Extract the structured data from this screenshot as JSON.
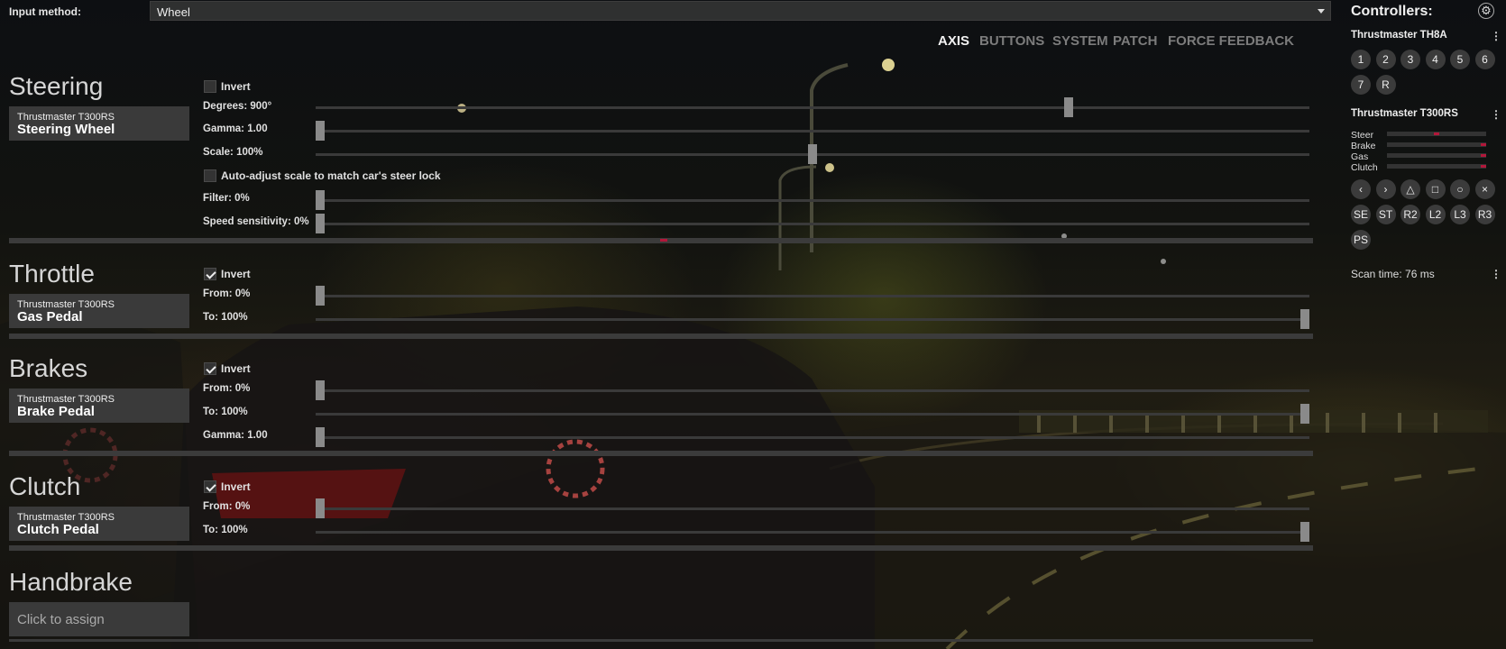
{
  "top": {
    "input_label": "Input method:",
    "input_value": "Wheel"
  },
  "tabs": [
    "AXIS",
    "BUTTONS",
    "SYSTEM",
    "PATCH",
    "FORCE FEEDBACK"
  ],
  "steering": {
    "title": "Steering",
    "vendor": "Thrustmaster T300RS",
    "device": "Steering Wheel",
    "invert_label": "Invert",
    "invert_checked": false,
    "degrees_label": "Degrees: 900°",
    "degrees_fraction": 0.76,
    "gamma_label": "Gamma: 1.00",
    "gamma_fraction": 0.0,
    "scale_label": "Scale: 100%",
    "scale_fraction": 0.5,
    "autoadjust_label": "Auto-adjust scale to match car's steer lock",
    "filter_label": "Filter: 0%",
    "filter_fraction": 0.0,
    "speed_label": "Speed sensitivity: 0%",
    "speed_fraction": 0.0
  },
  "throttle": {
    "title": "Throttle",
    "vendor": "Thrustmaster T300RS",
    "device": "Gas Pedal",
    "invert_label": "Invert",
    "invert_checked": true,
    "from_label": "From: 0%",
    "from_fraction": 0.0,
    "to_label": "To: 100%",
    "to_fraction": 1.0
  },
  "brakes": {
    "title": "Brakes",
    "vendor": "Thrustmaster T300RS",
    "device": "Brake Pedal",
    "invert_label": "Invert",
    "invert_checked": true,
    "from_label": "From: 0%",
    "from_fraction": 0.0,
    "to_label": "To: 100%",
    "to_fraction": 1.0,
    "gamma_label": "Gamma: 1.00",
    "gamma_fraction": 0.0
  },
  "clutch": {
    "title": "Clutch",
    "vendor": "Thrustmaster T300RS",
    "device": "Clutch Pedal",
    "invert_label": "Invert",
    "invert_checked": true,
    "from_label": "From: 0%",
    "from_fraction": 0.0,
    "to_label": "To: 100%",
    "to_fraction": 1.0
  },
  "handbrake": {
    "title": "Handbrake",
    "assign_text": "Click to assign"
  },
  "controllers": {
    "title": "Controllers:",
    "device1": {
      "name": "Thrustmaster TH8A",
      "buttons": [
        "1",
        "2",
        "3",
        "4",
        "5",
        "6",
        "7",
        "R"
      ]
    },
    "device2": {
      "name": "Thrustmaster T300RS",
      "axes": [
        {
          "name": "Steer",
          "value": 0.5
        },
        {
          "name": "Brake",
          "value": 1.0
        },
        {
          "name": "Gas",
          "value": 1.0
        },
        {
          "name": "Clutch",
          "value": 1.0
        }
      ],
      "buttons_row1": [
        "‹",
        "›",
        "△",
        "□",
        "○",
        "×"
      ],
      "buttons_row2": [
        "SE",
        "ST",
        "R2",
        "L2",
        "L3",
        "R3"
      ],
      "buttons_row3": [
        "PS"
      ]
    },
    "scan_time": "Scan time: 76 ms"
  },
  "colors": {
    "accent_red": "#b2173a",
    "panel_bg": "#3a3a3a",
    "track": "#3a3a3a",
    "thumb": "#8a8a8a"
  }
}
